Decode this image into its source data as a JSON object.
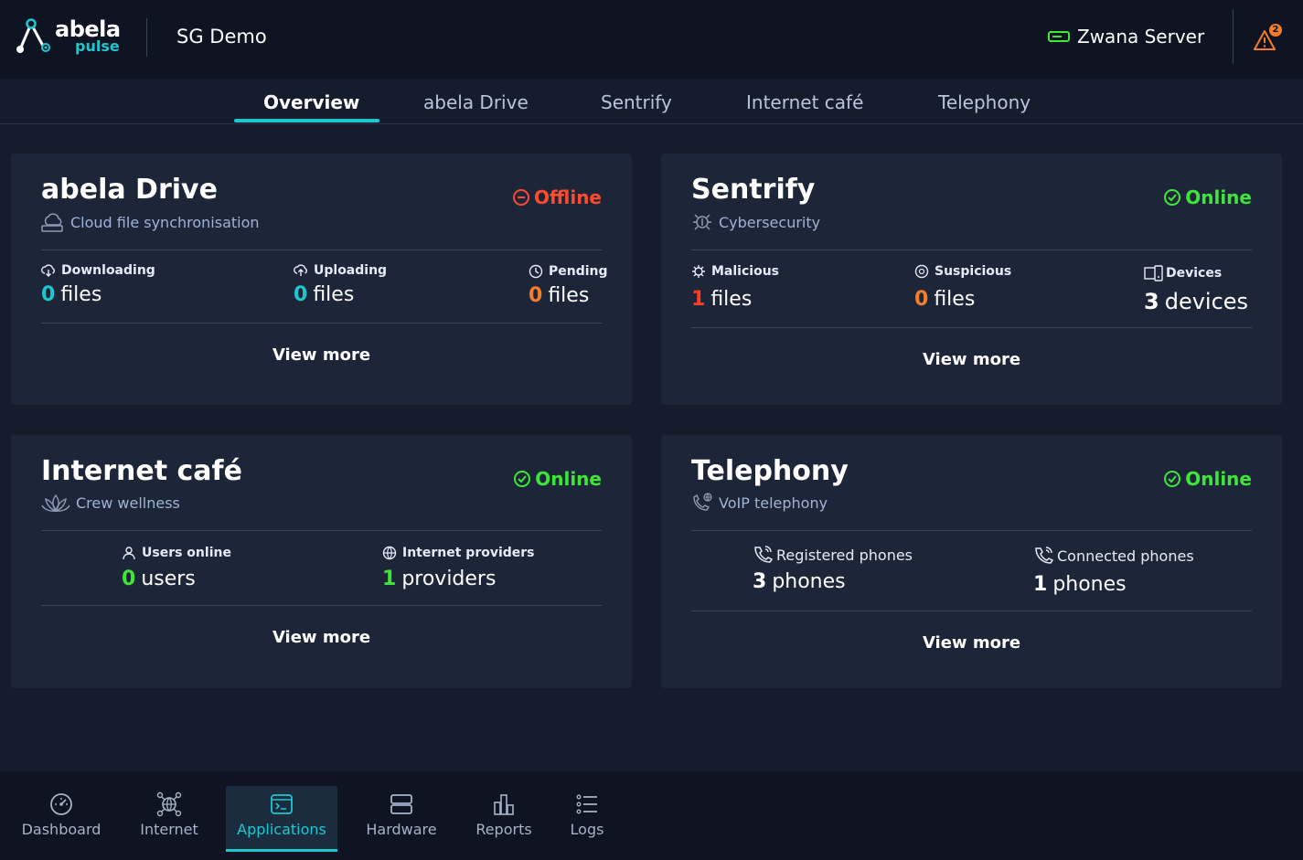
{
  "header": {
    "logo_word1": "abela",
    "logo_word2": "pulse",
    "site_title": "SG Demo",
    "server_name": "Zwana Server",
    "alert_count": "2"
  },
  "tabs": [
    {
      "label": "Overview",
      "active": true
    },
    {
      "label": "abela Drive"
    },
    {
      "label": "Sentrify"
    },
    {
      "label": "Internet café"
    },
    {
      "label": "Telephony"
    }
  ],
  "cards": {
    "drive": {
      "title": "abela Drive",
      "subtitle": "Cloud file synchronisation",
      "status": "Offline",
      "metrics": [
        {
          "label": "Downloading",
          "value": "0",
          "unit": "files"
        },
        {
          "label": "Uploading",
          "value": "0",
          "unit": "files"
        },
        {
          "label": "Pending",
          "value": "0",
          "unit": "files"
        }
      ],
      "view_more": "View more"
    },
    "sentrify": {
      "title": "Sentrify",
      "subtitle": "Cybersecurity",
      "status": "Online",
      "metrics": [
        {
          "label": "Malicious",
          "value": "1",
          "unit": "files"
        },
        {
          "label": "Suspicious",
          "value": "0",
          "unit": "files"
        },
        {
          "label": "Devices",
          "value": "3",
          "unit": "devices"
        }
      ],
      "view_more": "View more"
    },
    "cafe": {
      "title": "Internet café",
      "subtitle": "Crew wellness",
      "status": "Online",
      "metrics": [
        {
          "label": "Users online",
          "value": "0",
          "unit": "users"
        },
        {
          "label": "Internet providers",
          "value": "1",
          "unit": "providers"
        }
      ],
      "view_more": "View more"
    },
    "telephony": {
      "title": "Telephony",
      "subtitle": "VoIP telephony",
      "status": "Online",
      "metrics": [
        {
          "label": "Registered phones",
          "value": "3",
          "unit": "phones"
        },
        {
          "label": "Connected phones",
          "value": "1",
          "unit": "phones"
        }
      ],
      "view_more": "View more"
    }
  },
  "bottom_nav": [
    {
      "label": "Dashboard",
      "icon": "gauge-icon"
    },
    {
      "label": "Internet",
      "icon": "network-icon"
    },
    {
      "label": "Applications",
      "icon": "terminal-icon",
      "active": true
    },
    {
      "label": "Hardware",
      "icon": "server-icon"
    },
    {
      "label": "Reports",
      "icon": "bar-chart-icon"
    },
    {
      "label": "Logs",
      "icon": "list-icon"
    }
  ],
  "colors": {
    "accent": "#1ec6d0",
    "offline": "#ff4a2e",
    "online": "#3ee63a",
    "warning": "#f57c2b",
    "card_bg": "#1d2538",
    "page_bg": "#151c2c"
  }
}
